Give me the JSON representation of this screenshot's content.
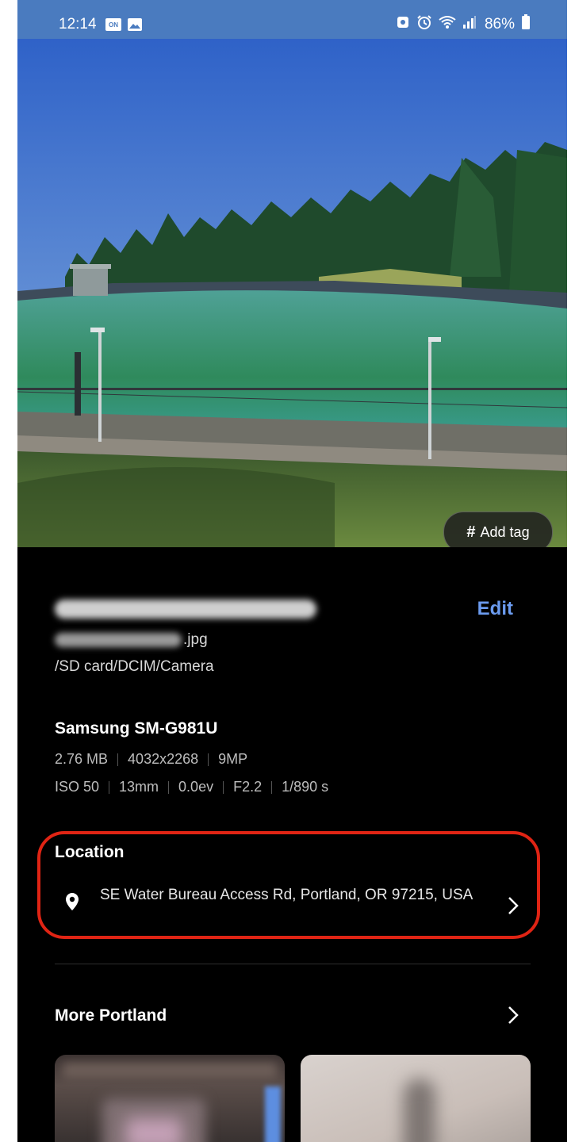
{
  "status_bar": {
    "time": "12:14",
    "battery": "86%"
  },
  "photo": {
    "add_tag_label": "Add tag",
    "add_tag_symbol": "#"
  },
  "details": {
    "edit_label": "Edit",
    "file_extension": ".jpg",
    "file_path": "/SD card/DCIM/Camera",
    "device": "Samsung SM-G981U",
    "file_size": "2.76 MB",
    "resolution": "4032x2268",
    "megapixels": "9MP",
    "iso": "ISO 50",
    "focal_length": "13mm",
    "exposure": "0.0ev",
    "aperture": "F2.2",
    "shutter": "1/890 s"
  },
  "location": {
    "title": "Location",
    "address": "SE Water Bureau Access Rd, Portland, OR 97215, USA"
  },
  "more": {
    "title": "More Portland"
  },
  "colors": {
    "status_bar": "#4a7bbf",
    "accent": "#6b9bef",
    "highlight": "#e02414"
  }
}
